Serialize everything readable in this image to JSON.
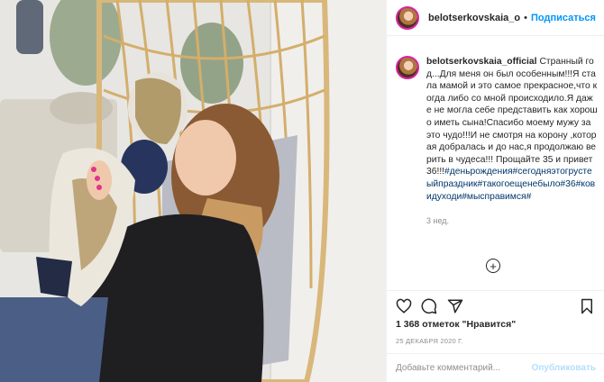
{
  "post": {
    "username": "belotserkovskaia_o",
    "follow_label": "Подписаться",
    "separator": "•",
    "caption_username": "belotserkovskaia_official",
    "caption_text": "Странный год...Для меня он был особенным!!!Я стала мамой и это самое прекрасное,что когда либо со мной происходило.Я даже не могла себе представить как хорошо иметь сына!Спасибо моему мужу за это чудо!!!И не смотря на корону ,которая добралась и до нас,я продолжаю верить в чудеса!!! Прощайте 35 и привет 36!!!",
    "hashtags": "#деньрождения#сегодняэтогрустеыйпраздник#такогоещенебыло#36#ковидуходи#мысправимся#",
    "time_ago": "3 нед.",
    "load_more_symbol": "+",
    "likes_text": "1 368 отметок \"Нравится\"",
    "date_text": "25 ДЕКАБРЯ 2020 Г.",
    "comment_placeholder": "Добавьте комментарий...",
    "publish_label": "Опубликовать"
  },
  "icons": {
    "avatar": "avatar",
    "like": "heart-icon",
    "comment": "comment-icon",
    "share": "paper-plane-icon",
    "save": "bookmark-icon",
    "load_more": "plus-circle-icon"
  },
  "colors": {
    "link_blue": "#0095f6",
    "hashtag_blue": "#00376b",
    "muted_gray": "#8e8e8e",
    "publish_disabled": "#b2dffc",
    "border": "#efefef"
  }
}
